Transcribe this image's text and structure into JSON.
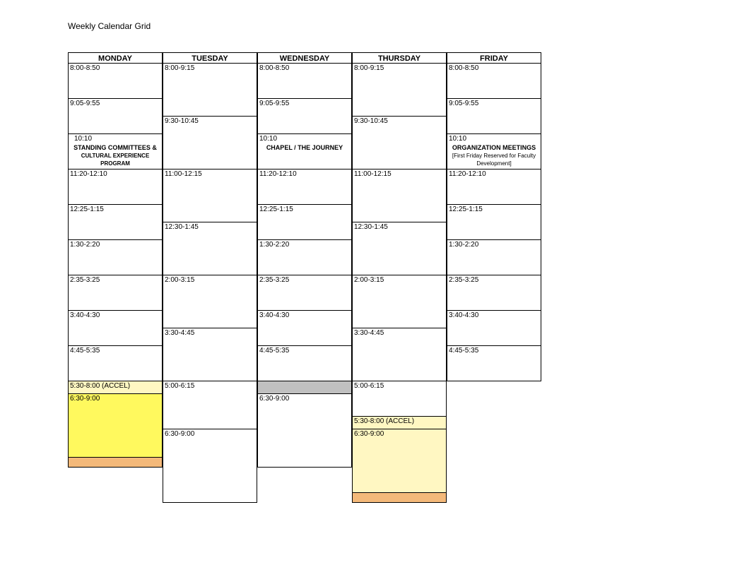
{
  "title": "Weekly Calendar Grid",
  "days": [
    "MONDAY",
    "TUESDAY",
    "WEDNESDAY",
    "THURSDAY",
    "FRIDAY"
  ],
  "columns": {
    "mon": {
      "slots": [
        {
          "time": "8:00-8:50"
        },
        {
          "time": "9:05-9:55"
        },
        {
          "time": "10:10",
          "title": "STANDING COMMITTEES &",
          "sub": "CULTURAL EXPERIENCE PROGRAM"
        },
        {
          "time": "11:20-12:10"
        },
        {
          "time": "12:25-1:15"
        },
        {
          "time": "1:30-2:20"
        },
        {
          "time": "2:35-3:25"
        },
        {
          "time": "3:40-4:30"
        },
        {
          "time": "4:45-5:35"
        },
        {
          "time": "5:30-8:00 (ACCEL)"
        },
        {
          "time": "6:30-9:00"
        }
      ]
    },
    "tue": {
      "slots": [
        {
          "time": "8:00-9:15"
        },
        {
          "time": "9:30-10:45"
        },
        {
          "time": "11:00-12:15"
        },
        {
          "time": "12:30-1:45"
        },
        {
          "time": "2:00-3:15"
        },
        {
          "time": "3:30-4:45"
        },
        {
          "time": "5:00-6:15"
        },
        {
          "time": "6:30-9:00"
        }
      ]
    },
    "wed": {
      "slots": [
        {
          "time": "8:00-8:50"
        },
        {
          "time": "9:05-9:55"
        },
        {
          "time": "10:10",
          "title": "CHAPEL / THE JOURNEY"
        },
        {
          "time": "11:20-12:10"
        },
        {
          "time": "12:25-1:15"
        },
        {
          "time": "1:30-2:20"
        },
        {
          "time": "2:35-3:25"
        },
        {
          "time": "3:40-4:30"
        },
        {
          "time": "4:45-5:35"
        },
        {
          "time": ""
        },
        {
          "time": "6:30-9:00"
        }
      ]
    },
    "thu": {
      "slots": [
        {
          "time": "8:00-9:15"
        },
        {
          "time": "9:30-10:45"
        },
        {
          "time": "11:00-12:15"
        },
        {
          "time": "12:30-1:45"
        },
        {
          "time": "2:00-3:15"
        },
        {
          "time": "3:30-4:45"
        },
        {
          "time": "5:00-6:15"
        },
        {
          "time": "5:30-8:00 (ACCEL)"
        },
        {
          "time": "6:30-9:00"
        }
      ]
    },
    "fri": {
      "slots": [
        {
          "time": "8:00-8:50"
        },
        {
          "time": "9:05-9:55"
        },
        {
          "time": "10:10",
          "title": "ORGANIZATION MEETINGS",
          "sub": "[First Friday Reserved for Faculty Development]"
        },
        {
          "time": "11:20-12:10"
        },
        {
          "time": "12:25-1:15"
        },
        {
          "time": "1:30-2:20"
        },
        {
          "time": "2:35-3:25"
        },
        {
          "time": "3:40-4:30"
        },
        {
          "time": "4:45-5:35"
        }
      ]
    }
  }
}
